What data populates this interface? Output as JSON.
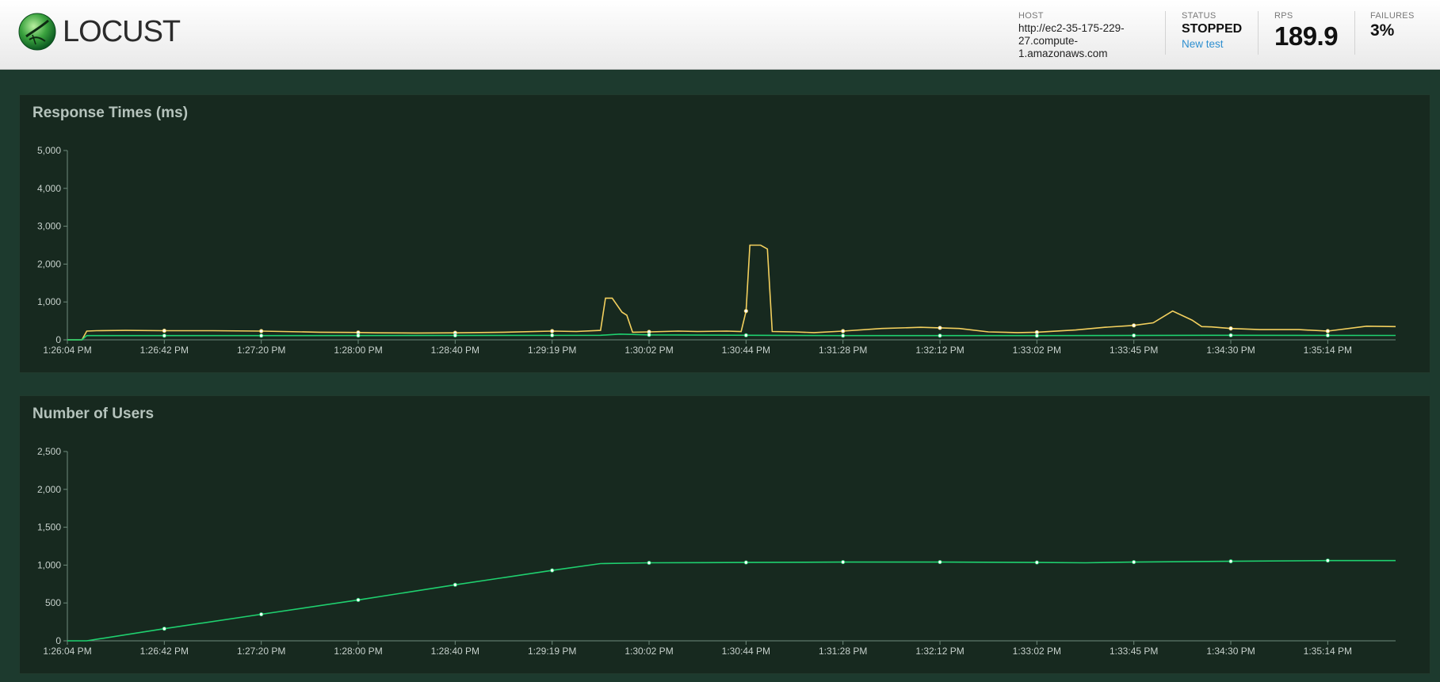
{
  "app": {
    "logo_text": "LOCUST"
  },
  "header": {
    "host": {
      "label": "HOST",
      "value": "http://ec2-35-175-229-27.compute-1.amazonaws.com",
      "lines": [
        "http://ec2-35-175-229-",
        "27.compute-",
        "1.amazonaws.com"
      ]
    },
    "status": {
      "label": "STATUS",
      "value": "STOPPED",
      "new_test_label": "New test"
    },
    "rps": {
      "label": "RPS",
      "value": "189.9"
    },
    "failures": {
      "label": "FAILURES",
      "value": "3%"
    }
  },
  "colors": {
    "p95": "#f3d05e",
    "median": "#1fd06f",
    "users": "#1fd06f",
    "axis": "#6f8a7c"
  },
  "x_tick_labels": [
    "1:26:04 PM",
    "1:26:42 PM",
    "1:27:20 PM",
    "1:28:00 PM",
    "1:28:40 PM",
    "1:29:19 PM",
    "1:30:02 PM",
    "1:30:44 PM",
    "1:31:28 PM",
    "1:32:12 PM",
    "1:33:02 PM",
    "1:33:45 PM",
    "1:34:30 PM",
    "1:35:14 PM"
  ],
  "chart_data": [
    {
      "type": "line",
      "title": "Response Times (ms)",
      "xlabel": "",
      "ylabel": "",
      "ylim": [
        0,
        5000
      ],
      "y_ticks": [
        0,
        1000,
        2000,
        3000,
        4000,
        5000
      ],
      "y_tick_labels": [
        "0",
        "1,000",
        "2,000",
        "3,000",
        "4,000",
        "5,000"
      ],
      "x_range": [
        0,
        13.7
      ],
      "grid": false,
      "series": [
        {
          "color_key": "p95",
          "x": [
            0,
            0.15,
            0.2,
            0.3,
            0.6,
            1.0,
            1.5,
            2.0,
            2.6,
            2.95,
            3.2,
            3.6,
            4.0,
            4.5,
            5.0,
            5.25,
            5.5,
            5.55,
            5.62,
            5.72,
            5.77,
            5.83,
            6.0,
            6.3,
            6.5,
            6.8,
            6.95,
            7.0,
            7.04,
            7.1,
            7.15,
            7.22,
            7.27,
            7.5,
            7.7,
            8.0,
            8.4,
            8.8,
            9.2,
            9.5,
            9.8,
            10.0,
            10.4,
            10.7,
            11.0,
            11.2,
            11.4,
            11.6,
            11.7,
            11.8,
            12.0,
            12.3,
            12.7,
            13.0,
            13.4,
            13.7
          ],
          "y": [
            0,
            0,
            230,
            240,
            250,
            240,
            240,
            230,
            200,
            195,
            185,
            180,
            185,
            200,
            230,
            220,
            250,
            1100,
            1100,
            730,
            650,
            200,
            210,
            230,
            220,
            230,
            220,
            760,
            2500,
            2500,
            2500,
            2400,
            220,
            210,
            190,
            230,
            300,
            330,
            300,
            210,
            190,
            200,
            260,
            330,
            380,
            450,
            760,
            520,
            350,
            340,
            300,
            270,
            270,
            230,
            360,
            350
          ]
        },
        {
          "color_key": "median",
          "x": [
            0,
            0.15,
            0.2,
            2.0,
            5.5,
            5.7,
            6.0,
            8.0,
            10.0,
            12.0,
            13.7
          ],
          "y": [
            0,
            0,
            110,
            110,
            120,
            150,
            130,
            110,
            110,
            120,
            115
          ]
        }
      ],
      "markers_x": [
        1,
        2,
        3,
        4,
        5,
        6,
        7,
        8,
        9,
        10,
        11,
        12,
        13
      ]
    },
    {
      "type": "line",
      "title": "Number of Users",
      "xlabel": "",
      "ylabel": "",
      "ylim": [
        0,
        2500
      ],
      "y_ticks": [
        0,
        500,
        1000,
        1500,
        2000,
        2500
      ],
      "y_tick_labels": [
        "0",
        "500",
        "1,000",
        "1,500",
        "2,000",
        "2,500"
      ],
      "x_range": [
        0,
        13.7
      ],
      "grid": false,
      "series": [
        {
          "color_key": "users",
          "x": [
            0,
            0.2,
            1,
            2,
            3,
            4,
            5,
            5.5,
            6,
            7,
            8,
            9,
            10,
            10.5,
            11,
            12,
            13,
            13.7
          ],
          "y": [
            0,
            0,
            160,
            350,
            540,
            740,
            930,
            1020,
            1030,
            1035,
            1040,
            1040,
            1035,
            1030,
            1040,
            1050,
            1060,
            1060
          ]
        }
      ],
      "markers_x": [
        1,
        2,
        3,
        4,
        5,
        6,
        7,
        8,
        9,
        10,
        11,
        12,
        13
      ]
    }
  ]
}
